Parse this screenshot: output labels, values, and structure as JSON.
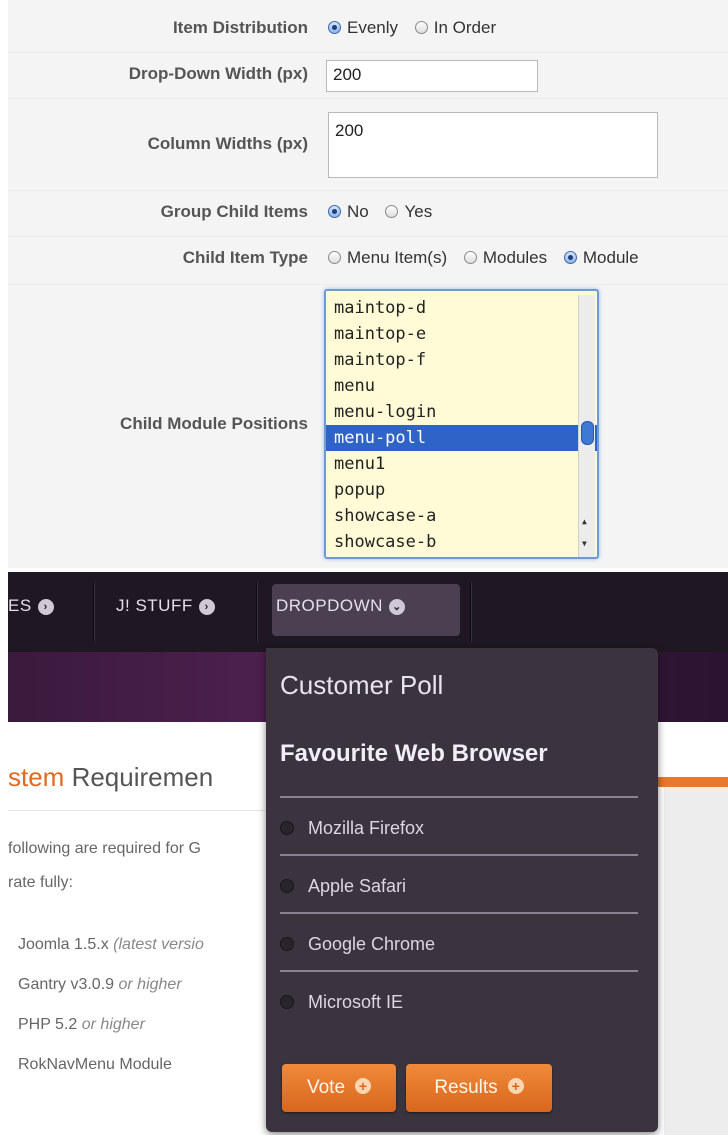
{
  "settings": {
    "item_distribution": {
      "label": "Item Distribution",
      "options": [
        "Evenly",
        "In Order"
      ],
      "selected": "Evenly"
    },
    "dropdown_width": {
      "label": "Drop-Down Width (px)",
      "value": "200"
    },
    "column_widths": {
      "label": "Column Widths (px)",
      "value": "200"
    },
    "group_child_items": {
      "label": "Group Child Items",
      "options": [
        "No",
        "Yes"
      ],
      "selected": "No"
    },
    "child_item_type": {
      "label": "Child Item Type",
      "options": [
        "Menu Item(s)",
        "Modules",
        "Module"
      ],
      "selected": "Module"
    },
    "child_module_positions": {
      "label": "Child Module Positions",
      "items": [
        "maintop-d",
        "maintop-e",
        "maintop-f",
        "menu",
        "menu-login",
        "menu-poll",
        "menu1",
        "popup",
        "showcase-a",
        "showcase-b"
      ],
      "selected": "menu-poll"
    }
  },
  "nav": {
    "items": [
      {
        "label": "ES",
        "chevron": "chevron-right-icon"
      },
      {
        "label": "J! STUFF",
        "chevron": "chevron-right-icon"
      },
      {
        "label": "DROPDOWN",
        "chevron": "chevron-down-icon"
      }
    ]
  },
  "content": {
    "heading_accent": "stem",
    "heading_rest": " Requiremen",
    "para_line1": "following are required for G",
    "para_line2": "rate fully:",
    "requirements": [
      {
        "main": "Joomla 1.5.x ",
        "note": "(latest versio"
      },
      {
        "main": "Gantry v3.0.9 ",
        "note": "or higher"
      },
      {
        "main": "PHP 5.2 ",
        "note": "or higher"
      },
      {
        "main": "RokNavMenu Module",
        "note": ""
      }
    ]
  },
  "poll": {
    "title": "Customer Poll",
    "question": "Favourite Web Browser",
    "options": [
      "Mozilla Firefox",
      "Apple Safari",
      "Google Chrome",
      "Microsoft IE"
    ],
    "vote_label": "Vote",
    "results_label": "Results"
  },
  "colors": {
    "accent_orange": "#e8782b",
    "nav_background": "#1f1822",
    "poll_background": "#3b343f",
    "listbox_selection": "#2f63c8",
    "listbox_background": "#fffbd6"
  }
}
